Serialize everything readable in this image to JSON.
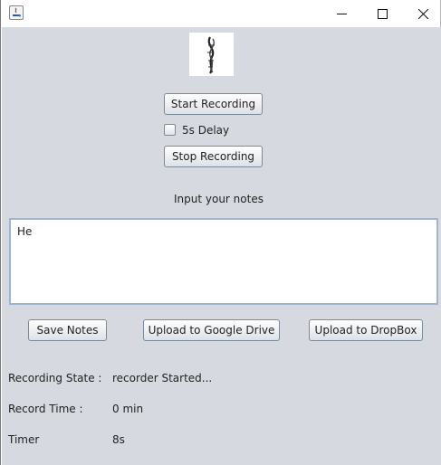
{
  "window": {
    "controls": {
      "minimize": "minimize-icon",
      "maximize": "maximize-icon",
      "close": "close-icon"
    }
  },
  "recording": {
    "start_label": "Start Recording",
    "delay_label": "5s Delay",
    "delay_checked": false,
    "stop_label": "Stop Recording"
  },
  "notes": {
    "heading": "Input your notes",
    "value": "He"
  },
  "actions": {
    "save_label": "Save Notes",
    "gdrive_label": "Upload to Google Drive",
    "dropbox_label": "Upload to DropBox"
  },
  "status": {
    "state_label": "Recording State :",
    "state_value": "recorder Started...",
    "time_label": "Record Time :",
    "time_value": "0 min",
    "timer_label": "Timer",
    "timer_value": "8s"
  },
  "colors": {
    "panel": "#d6d9df",
    "button_border": "#7a8a99",
    "field_border": "#9fb5cf"
  }
}
